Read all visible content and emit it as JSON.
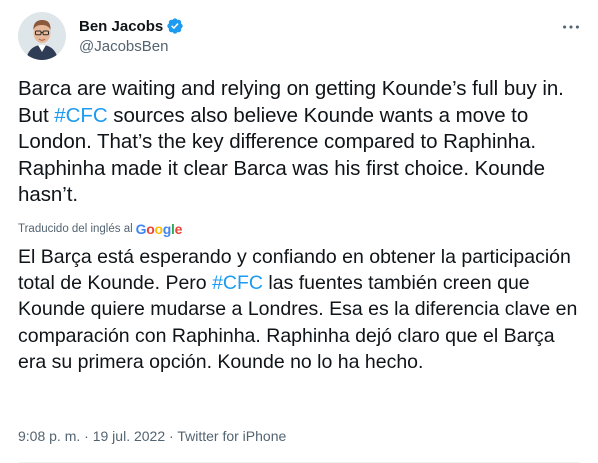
{
  "author": {
    "name": "Ben Jacobs",
    "handle": "@JacobsBen",
    "verified": true,
    "verified_color": "#1d9bf0"
  },
  "icons": {
    "avatar": "profile-photo-avatar",
    "verified": "verified-badge-icon",
    "more": "more-options-icon"
  },
  "tweet": {
    "text_before_tag": "Barca are waiting and relying on getting Kounde’s full buy in. But ",
    "hashtag": "#CFC",
    "text_after_tag": " sources also believe Kounde wants a move to London. That’s the key difference compared to Raphinha. Raphinha made it clear Barca was his first choice. Kounde hasn’t."
  },
  "translation": {
    "label": "Traducido del inglés al",
    "provider": "Google",
    "text_before_tag": "El Barça está esperando y confiando en obtener la participación total de Kounde. Pero ",
    "hashtag": "#CFC",
    "text_after_tag": " las fuentes también creen que Kounde quiere mudarse a Londres. Esa es la diferencia clave en comparación con Raphinha. Raphinha dejó claro que el Barça era su primera opción. Kounde no lo ha hecho."
  },
  "meta": {
    "time": "9:08 p. m.",
    "separator1": " · ",
    "date": "19 jul. 2022",
    "separator2": " · ",
    "source": "Twitter for iPhone"
  },
  "colors": {
    "link": "#1d9bf0",
    "secondary": "#536471",
    "text": "#0f1419"
  }
}
